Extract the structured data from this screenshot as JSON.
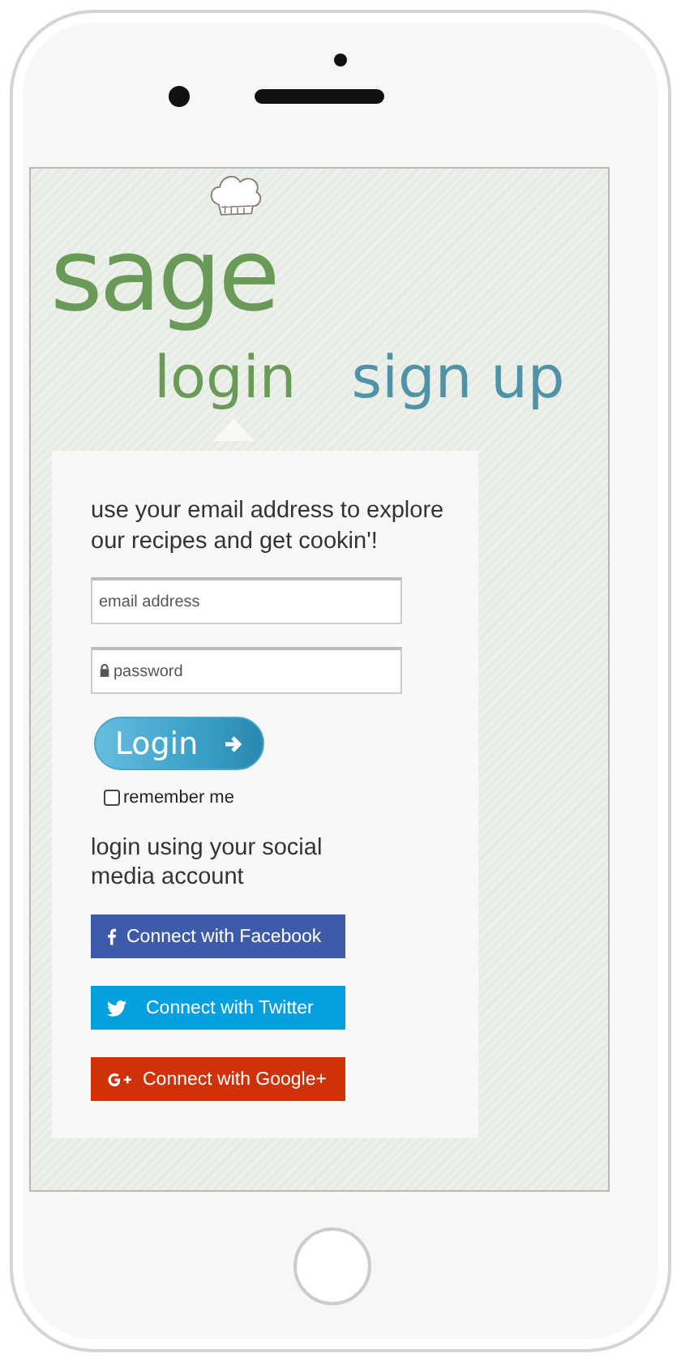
{
  "logo": "sage",
  "tabs": [
    {
      "label": "login",
      "selected": true
    },
    {
      "label": "sign up",
      "selected": false
    }
  ],
  "intro": "use your email address to explore our recipes and get cookin'!",
  "email": {
    "placeholder": "email address"
  },
  "password": {
    "placeholder": "password"
  },
  "login_button": "Login",
  "remember": {
    "label": "remember me",
    "checked": false
  },
  "social_heading": "login using your social media account",
  "social_buttons": [
    {
      "kind": "facebook",
      "label": "Connect with Facebook",
      "color": "#3d5ba9"
    },
    {
      "kind": "twitter",
      "label": "Connect with Twitter",
      "color": "#069fdf"
    },
    {
      "kind": "google",
      "label": "Connect with Google+",
      "color": "#cf3109"
    }
  ]
}
